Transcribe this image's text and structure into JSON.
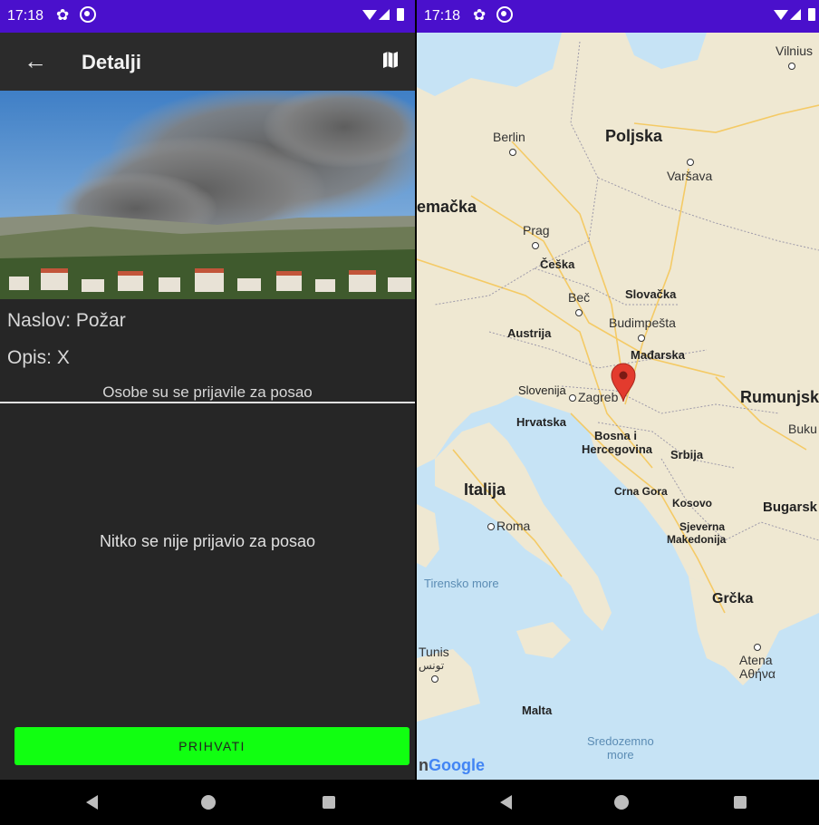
{
  "left": {
    "status": {
      "time": "17:18"
    },
    "appbar": {
      "title": "Detalji"
    },
    "details": {
      "naslov": "Naslov: Požar",
      "opis": "Opis: X",
      "applied_header": "Osobe su se prijavile za posao",
      "empty_message": "Nitko se nije prijavio za posao"
    },
    "accept_button": "PRIHVATI"
  },
  "right": {
    "status": {
      "time": "17:18"
    },
    "map": {
      "countries": {
        "poljska": "Poljska",
        "njemacka": "emačka",
        "italija": "Italija",
        "rumunjska": "Rumunjsk",
        "bugarska": "Bugarsk",
        "grcka": "Grčka"
      },
      "regions": {
        "ceska": "Češka",
        "slovacka": "Slovačka",
        "austrija": "Austrija",
        "madarska": "Mađarska",
        "slovenija": "Slovenija",
        "hrvatska": "Hrvatska",
        "bosna1": "Bosna i",
        "bosna2": "Hercegovina",
        "srbija": "Srbija",
        "crna_gora": "Crna Gora",
        "kosovo": "Kosovo",
        "makedonija1": "Sjeverna",
        "makedonija2": "Makedonija",
        "malta": "Malta"
      },
      "cities": {
        "vilnius": "Vilnius",
        "berlin": "Berlin",
        "varsava": "Varšava",
        "prag": "Prag",
        "bec": "Beč",
        "budimpesta": "Budimpešta",
        "zagreb": "Zagreb",
        "roma": "Roma",
        "bukurest": "Buku",
        "tunis1": "Tunis",
        "tunis2": "تونس",
        "atena1": "Atena",
        "atena2": "Αθήνα"
      },
      "seas": {
        "tirensko": "Tirensko more",
        "sredozemno1": "Sredozemno",
        "sredozemno2": "more"
      },
      "attribution": "Google",
      "attribution_prefix": "n"
    }
  },
  "colors": {
    "statusbar": "#4a10cc",
    "accent_button": "#11ff11",
    "background": "#262626",
    "map_pin": "#e33b2e"
  }
}
